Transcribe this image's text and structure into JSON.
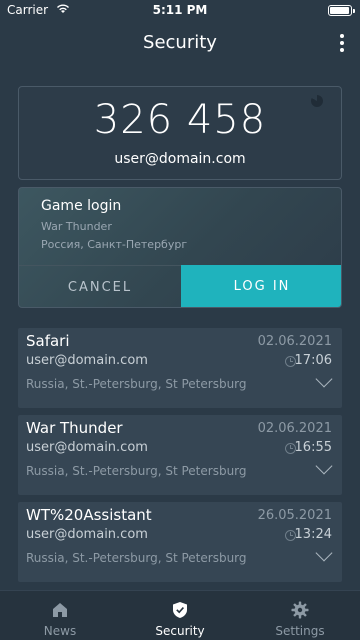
{
  "status_bar": {
    "carrier": "Carrier",
    "time": "5:11 PM"
  },
  "header": {
    "title": "Security"
  },
  "code_card": {
    "code": "326 458",
    "user": "user@domain.com"
  },
  "login_request": {
    "title": "Game login",
    "app": "War Thunder",
    "location": "Россия, Санкт-Петербург",
    "cancel_label": "CANCEL",
    "login_label": "LOG IN"
  },
  "sessions": [
    {
      "app": "Safari",
      "date": "02.06.2021",
      "user": "user@domain.com",
      "time": "17:06",
      "location": "Russia, St.-Petersburg, St Petersburg"
    },
    {
      "app": "War Thunder",
      "date": "02.06.2021",
      "user": "user@domain.com",
      "time": "16:55",
      "location": "Russia, St.-Petersburg, St Petersburg"
    },
    {
      "app": "WT%20Assistant",
      "date": "26.05.2021",
      "user": "user@domain.com",
      "time": "13:24",
      "location": "Russia, St.-Petersburg, St Petersburg"
    }
  ],
  "tab_bar": {
    "tabs": [
      {
        "label": "News",
        "icon": "home-icon"
      },
      {
        "label": "Security",
        "icon": "shield-icon"
      },
      {
        "label": "Settings",
        "icon": "gear-icon"
      }
    ],
    "active": "Security"
  },
  "colors": {
    "background": "#2b3a47",
    "accent": "#1fb3bd",
    "card": "#364654"
  }
}
